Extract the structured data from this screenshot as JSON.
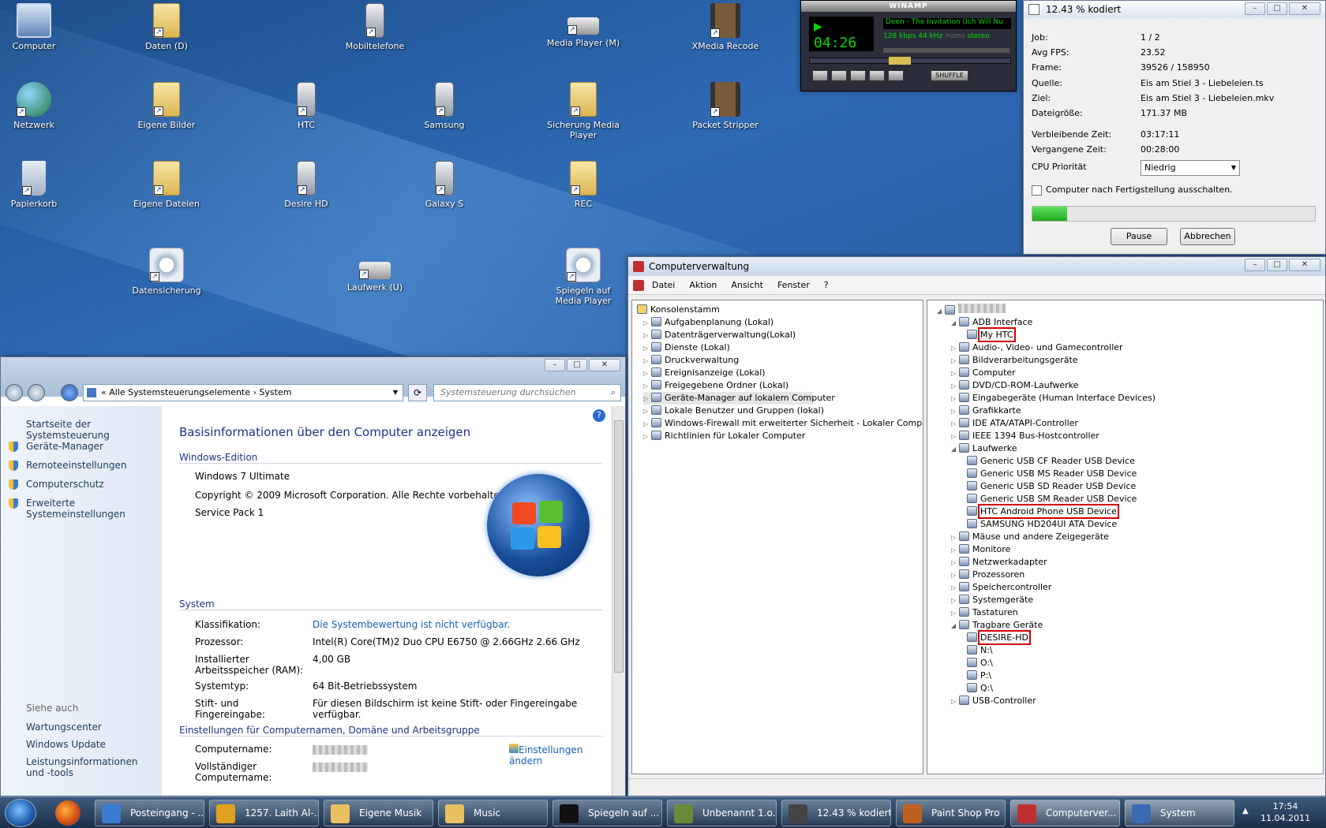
{
  "desktop": {
    "icons": [
      {
        "label": "Computer",
        "kind": "pc"
      },
      {
        "label": "Daten (D)",
        "kind": "folder"
      },
      {
        "label": "Mobiltelefone",
        "kind": "phone"
      },
      {
        "label": "Media Player (M)",
        "kind": "drive"
      },
      {
        "label": "XMedia Recode",
        "kind": "film"
      },
      {
        "label": "Netzwerk",
        "kind": "net"
      },
      {
        "label": "Eigene Bilder",
        "kind": "folder"
      },
      {
        "label": "HTC",
        "kind": "phone"
      },
      {
        "label": "Samsung",
        "kind": "phone"
      },
      {
        "label": "Sicherung Media Player",
        "kind": "folder"
      },
      {
        "label": "Packet Stripper",
        "kind": "film"
      },
      {
        "label": "Papierkorb",
        "kind": "bin"
      },
      {
        "label": "Eigene Dateien",
        "kind": "folder"
      },
      {
        "label": "Desire HD",
        "kind": "phone"
      },
      {
        "label": "Galaxy S",
        "kind": "phone"
      },
      {
        "label": "REC",
        "kind": "folder"
      },
      {
        "label": "Datensicherung",
        "kind": "gear"
      },
      {
        "label": "Laufwerk (U)",
        "kind": "drive"
      },
      {
        "label": "Spiegeln auf Media Player",
        "kind": "gear"
      }
    ]
  },
  "winamp": {
    "title": "WINAMP",
    "time": "04:26",
    "song": "Deen - The Invitation (Ich Will Nu",
    "kbps": "128",
    "khz": "44",
    "kbps_unit": "kbps",
    "khz_unit": "kHz",
    "mono": "mono",
    "stereo": "stereo",
    "shuffle": "SHUFFLE"
  },
  "encoder": {
    "title": "12.43 % kodiert",
    "rows": [
      {
        "label": "Job:",
        "value": "1 / 2"
      },
      {
        "label": "Avg FPS:",
        "value": "23.52"
      },
      {
        "label": "Frame:",
        "value": "39526 / 158950"
      },
      {
        "label": "Quelle:",
        "value": "Eis am Stiel 3 - Liebeleien.ts"
      },
      {
        "label": "Ziel:",
        "value": "Eis am Stiel 3 - Liebeleien.mkv"
      },
      {
        "label": "Dateigröße:",
        "value": "171.37 MB"
      },
      {
        "label": "Verbleibende Zeit:",
        "value": "03:17:11"
      },
      {
        "label": "Vergangene Zeit:",
        "value": "00:28:00"
      }
    ],
    "cpu_label": "CPU Priorität",
    "cpu_value": "Niedrig",
    "shutdown_label": "Computer nach Fertigstellung ausschalten.",
    "progress": 0.1243,
    "pause": "Pause",
    "cancel": "Abbrechen"
  },
  "compmgmt": {
    "title": "Computerverwaltung",
    "menu": [
      "Datei",
      "Aktion",
      "Ansicht",
      "Fenster",
      "?"
    ],
    "left_root": "Konsolenstamm",
    "left_items": [
      "Aufgabenplanung (Lokal)",
      "Datenträgerverwaltung(Lokal)",
      "Dienste (Lokal)",
      "Druckverwaltung",
      "Ereignisanzeige (Lokal)",
      "Freigegebene Ordner (Lokal)",
      "Geräte-Manager auf lokalem Computer",
      "Lokale Benutzer und Gruppen (lokal)",
      "Windows-Firewall mit erweiterter Sicherheit - Lokaler Computer",
      "Richtlinien für Lokaler Computer"
    ],
    "tree": [
      {
        "text": "ADB Interface",
        "level": 1,
        "open": true
      },
      {
        "text": "My HTC",
        "level": 2,
        "hl": true
      },
      {
        "text": "Audio-, Video- und Gamecontroller",
        "level": 1
      },
      {
        "text": "Bildverarbeitungsgeräte",
        "level": 1
      },
      {
        "text": "Computer",
        "level": 1
      },
      {
        "text": "DVD/CD-ROM-Laufwerke",
        "level": 1
      },
      {
        "text": "Eingabegeräte (Human Interface Devices)",
        "level": 1
      },
      {
        "text": "Grafikkarte",
        "level": 1
      },
      {
        "text": "IDE ATA/ATAPI-Controller",
        "level": 1
      },
      {
        "text": "IEEE 1394 Bus-Hostcontroller",
        "level": 1
      },
      {
        "text": "Laufwerke",
        "level": 1,
        "open": true
      },
      {
        "text": "Generic USB CF Reader USB Device",
        "level": 2
      },
      {
        "text": "Generic USB MS Reader USB Device",
        "level": 2
      },
      {
        "text": "Generic USB SD Reader USB Device",
        "level": 2
      },
      {
        "text": "Generic USB SM Reader USB Device",
        "level": 2
      },
      {
        "text": "HTC Android Phone USB Device",
        "level": 2,
        "hl": true
      },
      {
        "text": "SAMSUNG HD204UI ATA Device",
        "level": 2
      },
      {
        "text": "Mäuse und andere Zeigegeräte",
        "level": 1
      },
      {
        "text": "Monitore",
        "level": 1
      },
      {
        "text": "Netzwerkadapter",
        "level": 1
      },
      {
        "text": "Prozessoren",
        "level": 1
      },
      {
        "text": "Speichercontroller",
        "level": 1
      },
      {
        "text": "Systemgeräte",
        "level": 1
      },
      {
        "text": "Tastaturen",
        "level": 1
      },
      {
        "text": "Tragbare Geräte",
        "level": 1,
        "open": true
      },
      {
        "text": "DESIRE-HD",
        "level": 2,
        "hl": true
      },
      {
        "text": "N:\\",
        "level": 2
      },
      {
        "text": "O:\\",
        "level": 2
      },
      {
        "text": "P:\\",
        "level": 2
      },
      {
        "text": "Q:\\",
        "level": 2
      },
      {
        "text": "USB-Controller",
        "level": 1
      }
    ]
  },
  "system": {
    "address": [
      "Alle Systemsteuerungselemente",
      "System"
    ],
    "search_placeholder": "Systemsteuerung durchsuchen",
    "left_links": [
      "Startseite der Systemsteuerung",
      "Geräte-Manager",
      "Remoteeinstellungen",
      "Computerschutz",
      "Erweiterte Systemeinstellungen"
    ],
    "see_also": "Siehe auch",
    "see_links": [
      "Wartungscenter",
      "Windows Update",
      "Leistungsinformationen und -tools"
    ],
    "heading": "Basisinformationen über den Computer anzeigen",
    "edition_title": "Windows-Edition",
    "edition": [
      "Windows 7 Ultimate",
      "Copyright © 2009 Microsoft Corporation. Alle Rechte vorbehalten.",
      "Service Pack 1"
    ],
    "system_title": "System",
    "rows": [
      {
        "label": "Klassifikation:",
        "value": "Die Systembewertung ist nicht verfügbar."
      },
      {
        "label": "Prozessor:",
        "value": "Intel(R) Core(TM)2 Duo CPU     E6750  @ 2.66GHz   2.66 GHz"
      },
      {
        "label": "Installierter Arbeitsspeicher (RAM):",
        "value": "4,00 GB"
      },
      {
        "label": "Systemtyp:",
        "value": "64 Bit-Betriebssystem"
      },
      {
        "label": "Stift- und Fingereingabe:",
        "value": "Für diesen Bildschirm ist keine Stift- oder Fingereingabe verfügbar."
      }
    ],
    "name_title": "Einstellungen für Computernamen, Domäne und Arbeitsgruppe",
    "name_rows": [
      "Computername:",
      "Vollständiger Computername:"
    ],
    "change_settings": "Einstellungen ändern"
  },
  "taskbar": {
    "items": [
      {
        "label": "Posteingang - ...",
        "color": "#3b7bd0"
      },
      {
        "label": "1257. Laith Al-...",
        "color": "#e0a020"
      },
      {
        "label": "Eigene Musik",
        "color": "#e8c060"
      },
      {
        "label": "Music",
        "color": "#e8c060"
      },
      {
        "label": "Spiegeln auf ...",
        "color": "#111111"
      },
      {
        "label": "Unbenannt 1.o...",
        "color": "#6a8a3a"
      },
      {
        "label": "12.43 % kodiert",
        "color": "#444444"
      },
      {
        "label": "Paint Shop Pro",
        "color": "#c06020"
      },
      {
        "label": "Computerver...",
        "color": "#c03030"
      },
      {
        "label": "System",
        "color": "#3a6ab0"
      }
    ],
    "time": "17:54",
    "date": "11.04.2011"
  }
}
